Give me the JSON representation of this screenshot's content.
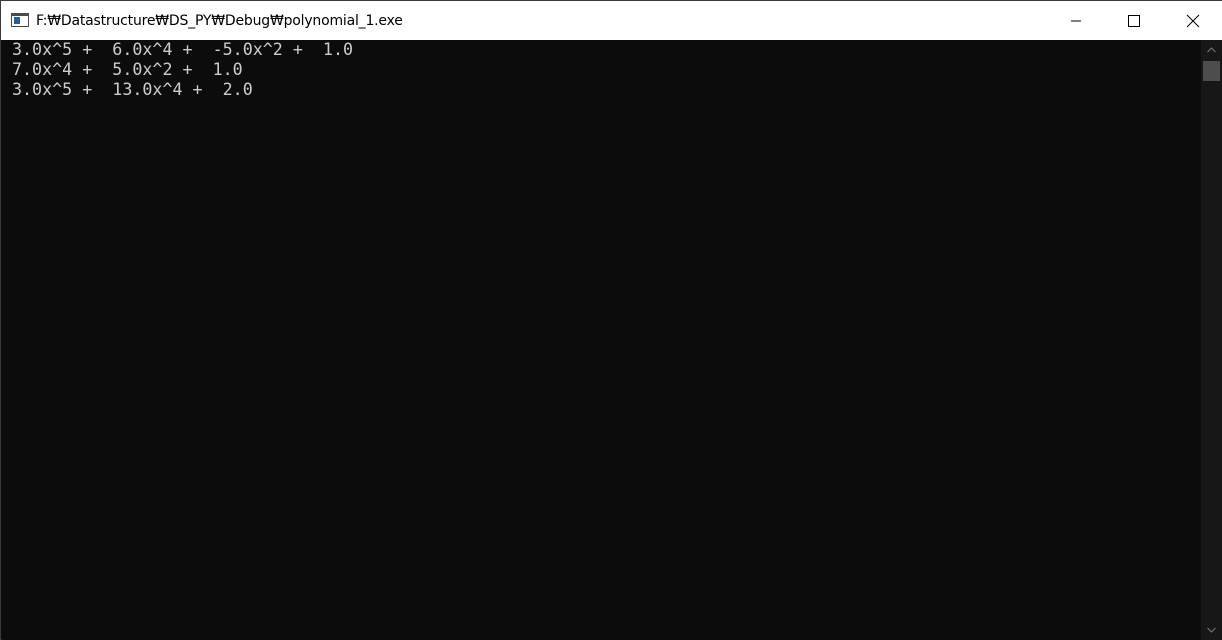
{
  "window": {
    "title": "F:₩Datastructure₩DS_PY₩Debug₩polynomial_1.exe",
    "icon": "console-app-icon"
  },
  "titlebar_buttons": {
    "minimize_icon": "minimize-icon",
    "maximize_icon": "maximize-icon",
    "close_icon": "close-icon"
  },
  "console": {
    "lines": [
      "3.0x^5 +  6.0x^4 +  -5.0x^2 +  1.0",
      "7.0x^4 +  5.0x^2 +  1.0",
      "3.0x^5 +  13.0x^4 +  2.0"
    ]
  },
  "colors": {
    "console_bg": "#0c0c0c",
    "console_fg": "#cccccc",
    "titlebar_bg": "#ffffff"
  }
}
